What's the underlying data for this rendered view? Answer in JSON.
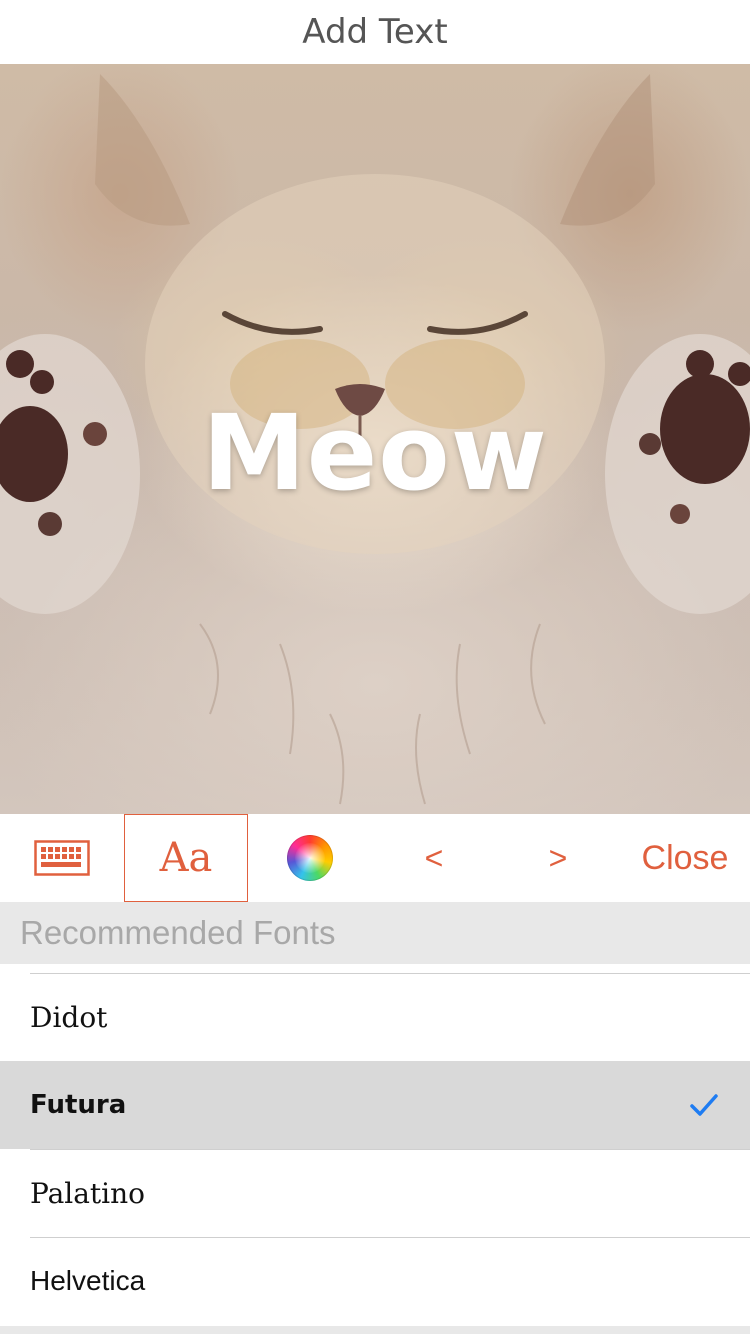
{
  "title": "Add Text",
  "photo": {
    "overlay_text": "Meow"
  },
  "toolbar": {
    "keyboard_icon": "keyboard-icon",
    "font_label": "Aa",
    "color_icon": "color-wheel-icon",
    "prev_label": "<",
    "next_label": ">",
    "close_label": "Close",
    "accent_color": "#e0603e"
  },
  "fonts_section": {
    "header": "Recommended Fonts",
    "items": [
      {
        "label": "Didot",
        "selected": false
      },
      {
        "label": "Futura",
        "selected": true
      },
      {
        "label": "Palatino",
        "selected": false
      },
      {
        "label": "Helvetica",
        "selected": false
      }
    ],
    "check_color": "#1e7cf2"
  }
}
